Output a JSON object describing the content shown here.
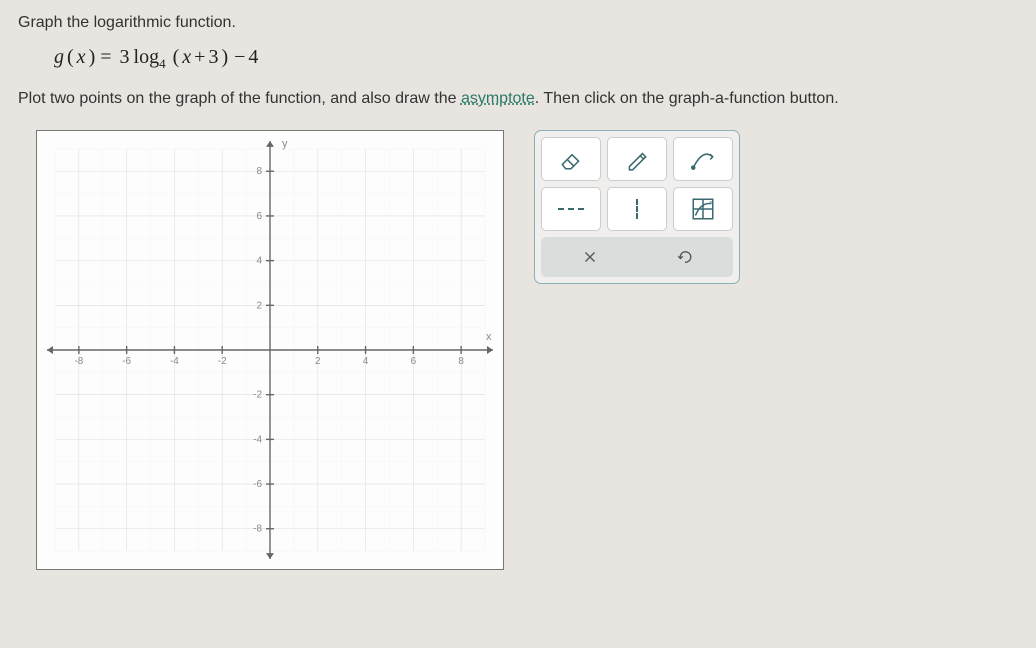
{
  "prompt": {
    "line1": "Graph the logarithmic function.",
    "formula_fn": "g",
    "formula_var": "x",
    "formula_coef": "3",
    "formula_log": "log",
    "formula_base": "4",
    "formula_arg_open": "(",
    "formula_arg_var": "x",
    "formula_arg_op": "+",
    "formula_arg_const": "3",
    "formula_arg_close": ")",
    "formula_tail_op": "−",
    "formula_tail_const": "4",
    "line2_a": "Plot two points on the graph of the function, and also draw the ",
    "line2_link": "asymptote",
    "line2_b": ". Then click on the graph-a-function button."
  },
  "graph": {
    "x_axis_label": "x",
    "y_axis_label": "y",
    "x_ticks": [
      "-8",
      "-6",
      "-4",
      "-2",
      "2",
      "4",
      "6",
      "8"
    ],
    "y_ticks": [
      "8",
      "6",
      "4",
      "2",
      "-2",
      "-4",
      "-6",
      "-8"
    ]
  },
  "tools": {
    "eraser": "eraser-tool",
    "pencil": "pencil-tool",
    "curve": "curve-tool",
    "hline": "dashed-horizontal-line-tool",
    "vline": "dashed-vertical-line-tool",
    "graphfn": "graph-a-function-button",
    "clear": "clear-button",
    "undo": "undo-button"
  },
  "chart_data": {
    "type": "line",
    "title": "",
    "xlabel": "x",
    "ylabel": "y",
    "xlim": [
      -9,
      9
    ],
    "ylim": [
      -9,
      9
    ],
    "x_ticks": [
      -8,
      -6,
      -4,
      -2,
      0,
      2,
      4,
      6,
      8
    ],
    "y_ticks": [
      -8,
      -6,
      -4,
      -2,
      0,
      2,
      4,
      6,
      8
    ],
    "grid": true,
    "series": []
  }
}
